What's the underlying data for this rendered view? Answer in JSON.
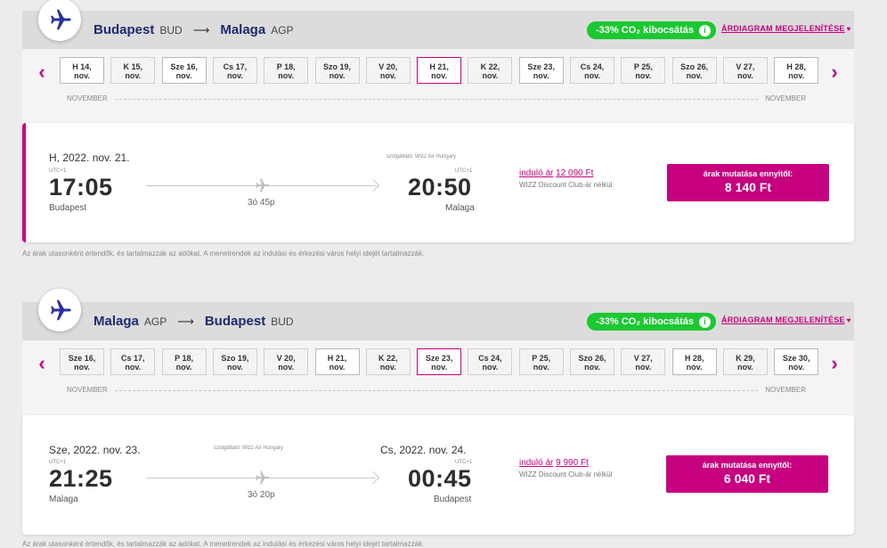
{
  "outbound": {
    "origin_city": "Budapest",
    "origin_code": "BUD",
    "dest_city": "Malaga",
    "dest_code": "AGP",
    "co2": "-33% CO₂ kibocsátás",
    "diagram_link": "ÁRDIAGRAM MEGJELENÍTÉSE",
    "dates": [
      {
        "d": "H 14,",
        "m": "nov.",
        "style": "white"
      },
      {
        "d": "K 15,",
        "m": "nov.",
        "style": "grey"
      },
      {
        "d": "Sze 16,",
        "m": "nov.",
        "style": "white"
      },
      {
        "d": "Cs 17,",
        "m": "nov.",
        "style": "grey"
      },
      {
        "d": "P 18,",
        "m": "nov.",
        "style": "grey"
      },
      {
        "d": "Szo 19,",
        "m": "nov.",
        "style": "grey"
      },
      {
        "d": "V 20,",
        "m": "nov.",
        "style": "grey"
      },
      {
        "d": "H 21,",
        "m": "nov.",
        "style": "selected"
      },
      {
        "d": "K 22,",
        "m": "nov.",
        "style": "grey"
      },
      {
        "d": "Sze 23,",
        "m": "nov.",
        "style": "white"
      },
      {
        "d": "Cs 24,",
        "m": "nov.",
        "style": "grey"
      },
      {
        "d": "P 25,",
        "m": "nov.",
        "style": "grey"
      },
      {
        "d": "Szo 26,",
        "m": "nov.",
        "style": "grey"
      },
      {
        "d": "V 27,",
        "m": "nov.",
        "style": "grey"
      },
      {
        "d": "H 28,",
        "m": "nov.",
        "style": "white"
      }
    ],
    "month_left": "NOVEMBER",
    "month_right": "NOVEMBER",
    "flight": {
      "dep_date": "H, 2022. nov. 21.",
      "arr_date": "",
      "dep_utc": "UTC+1",
      "arr_utc": "UTC+1",
      "dep_time": "17:05",
      "arr_time": "20:50",
      "dep_place": "Budapest",
      "arr_place": "Malaga",
      "operator": "szolgáltató: Wizz Air Hungary",
      "duration": "3ó 45p",
      "start_price_label": "induló ár",
      "start_price_value": "12 090 Ft",
      "club_note": "WIZZ Discount Club-ár nélkül",
      "btn_label": "árak mutatása ennyitől:",
      "btn_value": "8 140 Ft"
    },
    "note": "Az árak utasonként értendők, és tartalmazzák az adókat. A menetrendek az indulási és érkezési város helyi idejét tartalmazzák."
  },
  "return": {
    "origin_city": "Malaga",
    "origin_code": "AGP",
    "dest_city": "Budapest",
    "dest_code": "BUD",
    "co2": "-33% CO₂ kibocsátás",
    "diagram_link": "ÁRDIAGRAM MEGJELENÍTÉSE",
    "dates": [
      {
        "d": "Sze 16,",
        "m": "nov.",
        "style": "grey"
      },
      {
        "d": "Cs 17,",
        "m": "nov.",
        "style": "grey"
      },
      {
        "d": "P 18,",
        "m": "nov.",
        "style": "grey"
      },
      {
        "d": "Szo 19,",
        "m": "nov.",
        "style": "grey"
      },
      {
        "d": "V 20,",
        "m": "nov.",
        "style": "grey"
      },
      {
        "d": "H 21,",
        "m": "nov.",
        "style": "white"
      },
      {
        "d": "K 22,",
        "m": "nov.",
        "style": "grey"
      },
      {
        "d": "Sze 23,",
        "m": "nov.",
        "style": "selected"
      },
      {
        "d": "Cs 24,",
        "m": "nov.",
        "style": "grey"
      },
      {
        "d": "P 25,",
        "m": "nov.",
        "style": "grey"
      },
      {
        "d": "Szo 26,",
        "m": "nov.",
        "style": "grey"
      },
      {
        "d": "V 27,",
        "m": "nov.",
        "style": "grey"
      },
      {
        "d": "H 28,",
        "m": "nov.",
        "style": "white"
      },
      {
        "d": "K 29,",
        "m": "nov.",
        "style": "grey"
      },
      {
        "d": "Sze 30,",
        "m": "nov.",
        "style": "white"
      }
    ],
    "month_left": "NOVEMBER",
    "month_right": "NOVEMBER",
    "flight": {
      "dep_date": "Sze, 2022. nov. 23.",
      "arr_date": "Cs, 2022. nov. 24.",
      "dep_utc": "UTC+1",
      "arr_utc": "UTC+1",
      "dep_time": "21:25",
      "arr_time": "00:45",
      "dep_place": "Malaga",
      "arr_place": "Budapest",
      "operator": "szolgáltató: Wizz Air Hungary",
      "duration": "3ó 20p",
      "start_price_label": "induló ár",
      "start_price_value": "9 990 Ft",
      "club_note": "WIZZ Discount Club-ár nélkül",
      "btn_label": "árak mutatása ennyitől:",
      "btn_value": "6 040 Ft"
    },
    "note": "Az árak utasonként értendők, és tartalmazzák az adókat. A menetrendek az indulási és érkezési város helyi idejét tartalmazzák."
  },
  "colors": {
    "brand": "#c6007e",
    "navy": "#1e2a6f",
    "co2_green": "#1bc832"
  },
  "icons": [
    "plane-icon",
    "chevron-left-icon",
    "chevron-right-icon",
    "info-icon",
    "heart-icon",
    "arrow-right-icon"
  ]
}
